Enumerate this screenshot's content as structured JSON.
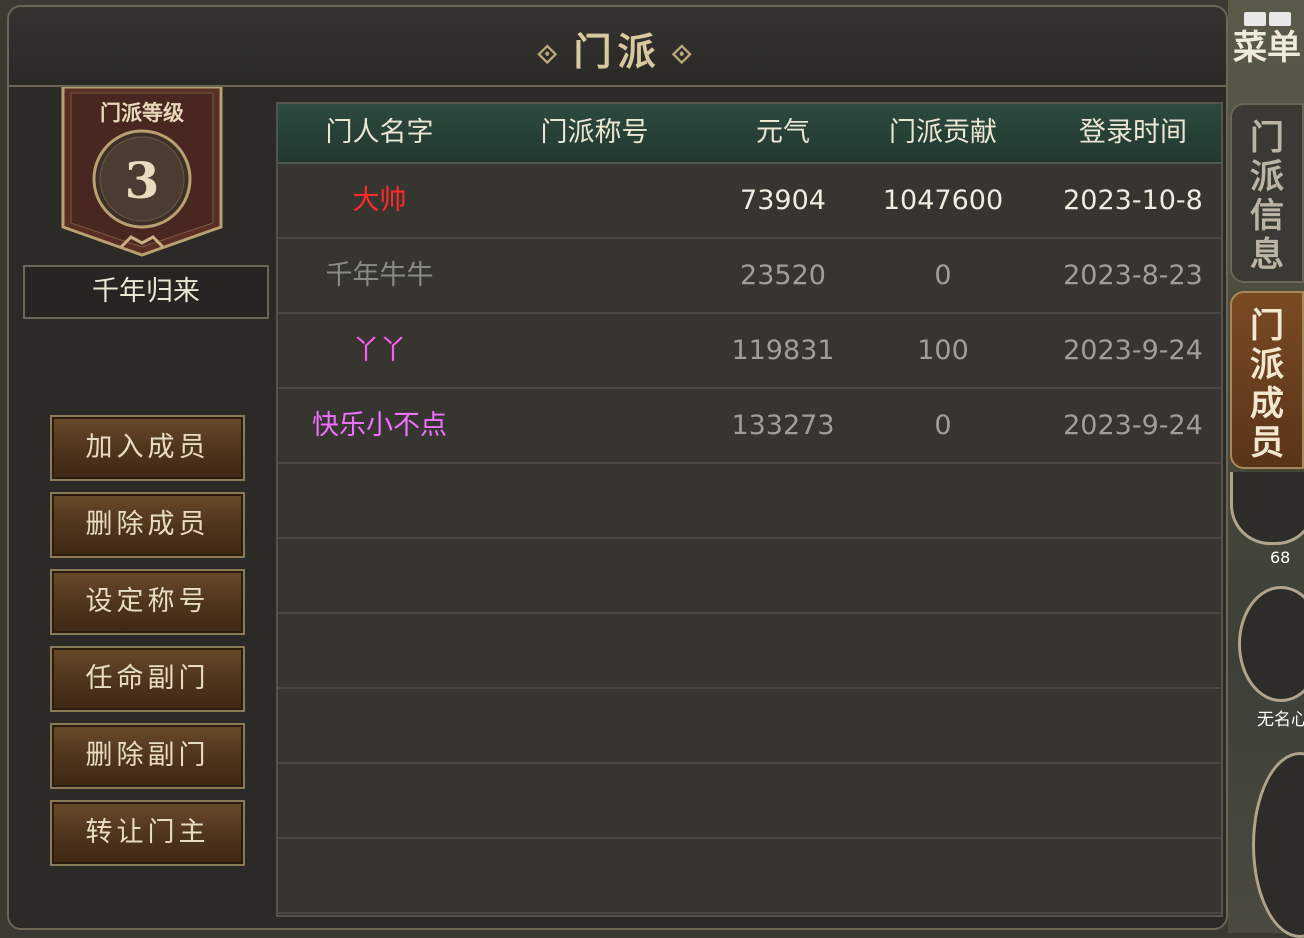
{
  "window": {
    "title": "门派"
  },
  "menu": {
    "label_1": "菜",
    "label_2": "单"
  },
  "sect": {
    "level_label": "门派等级",
    "level": "3",
    "name": "千年归来"
  },
  "actions": [
    {
      "label": "加入成员"
    },
    {
      "label": "删除成员"
    },
    {
      "label": "设定称号"
    },
    {
      "label": "任命副门"
    },
    {
      "label": "删除副门"
    },
    {
      "label": "转让门主"
    }
  ],
  "table": {
    "headers": [
      "门人名字",
      "门派称号",
      "元气",
      "门派贡献",
      "登录时间"
    ],
    "rows": [
      {
        "name": "大帅",
        "title": "",
        "vitality": "73904",
        "contribution": "1047600",
        "login": "2023-10-8",
        "name_color": "#ff2a2a",
        "value_color": "#f0ece0"
      },
      {
        "name": "千年牛牛",
        "title": "",
        "vitality": "23520",
        "contribution": "0",
        "login": "2023-8-23",
        "name_color": "#8a8a84",
        "value_color": "#a09e96"
      },
      {
        "name": "丫丫",
        "title": "",
        "vitality": "119831",
        "contribution": "100",
        "login": "2023-9-24",
        "name_color": "#ff5cf0",
        "value_color": "#a09e96"
      },
      {
        "name": "快乐小不点",
        "title": "",
        "vitality": "133273",
        "contribution": "0",
        "login": "2023-9-24",
        "name_color": "#f070ff",
        "value_color": "#a09e96"
      }
    ],
    "empty_rows": 6
  },
  "side_tabs": [
    {
      "label": "门派信息",
      "active": false
    },
    {
      "label": "门派成员",
      "active": true
    }
  ],
  "hud": {
    "count": "68",
    "skill_label": "无名心"
  }
}
